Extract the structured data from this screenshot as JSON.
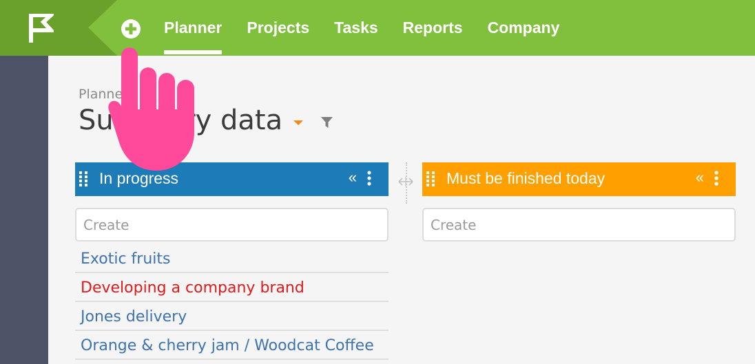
{
  "nav": {
    "items": [
      {
        "label": "Planner",
        "active": true
      },
      {
        "label": "Projects"
      },
      {
        "label": "Tasks"
      },
      {
        "label": "Reports"
      },
      {
        "label": "Company"
      }
    ]
  },
  "breadcrumb": "Planne",
  "page_title": "Summary data",
  "columns": [
    {
      "title": "In progress",
      "color": "#1d7bb7",
      "collapse_glyph": "«",
      "create_placeholder": "Create"
    },
    {
      "title": "Must be finished today",
      "color": "#ffa000",
      "collapse_glyph": "«",
      "create_placeholder": "Create"
    }
  ],
  "tasks": [
    {
      "label": "Exotic fruits",
      "color": "#3d72b0"
    },
    {
      "label": "Developing a company brand",
      "color": "#e01a1a"
    },
    {
      "label": "Jones delivery",
      "color": "#3d72b0"
    },
    {
      "label": "Orange & cherry jam / Woodcat Coffee",
      "color": "#3d72b0"
    }
  ],
  "colors": {
    "topbar": "#80c03c",
    "logo_bg": "#6aa12a",
    "sidebar": "#4e5468",
    "caret": "#f08c1e",
    "pointer": "#ff4a9c"
  },
  "icons": [
    "flag-icon",
    "plus-circle-icon",
    "caret-down-icon",
    "filter-icon",
    "drag-handle-icon",
    "collapse-icon",
    "kebab-icon",
    "resize-icon",
    "pointer-hand-icon"
  ]
}
